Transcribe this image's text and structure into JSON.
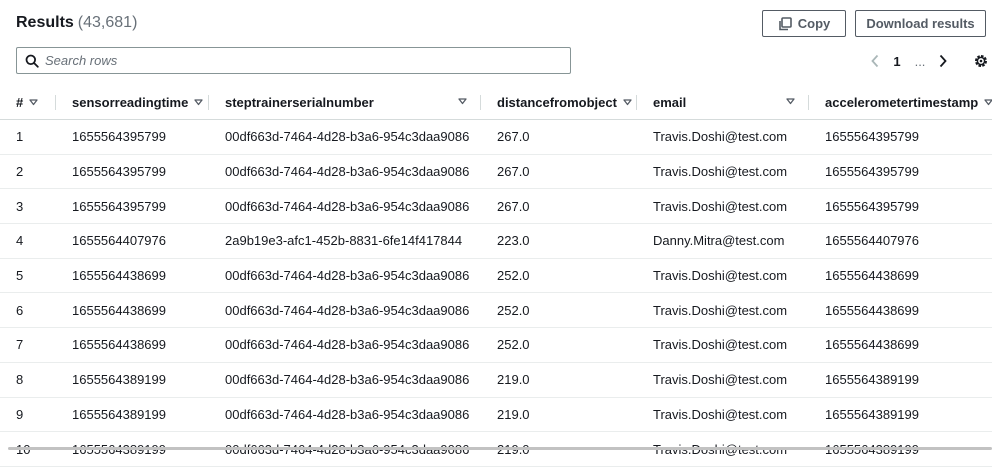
{
  "header": {
    "title": "Results",
    "count": "(43,681)"
  },
  "toolbar": {
    "copy_label": "Copy",
    "download_label": "Download results"
  },
  "search": {
    "placeholder": "Search rows",
    "value": ""
  },
  "pagination": {
    "current_page": "1",
    "ellipsis": "..."
  },
  "icons": {
    "search": "search-icon",
    "copy": "copy-icon",
    "prev": "chevron-left-icon",
    "next": "chevron-right-icon",
    "settings": "gear-icon",
    "sort": "sort-caret-down-icon"
  },
  "table": {
    "columns": [
      "#",
      "sensorreadingtime",
      "steptrainerserialnumber",
      "distancefromobject",
      "email",
      "accelerometertimestamp"
    ],
    "rows": [
      [
        "1",
        "1655564395799",
        "00df663d-7464-4d28-b3a6-954c3daa9086",
        "267.0",
        "Travis.Doshi@test.com",
        "1655564395799"
      ],
      [
        "2",
        "1655564395799",
        "00df663d-7464-4d28-b3a6-954c3daa9086",
        "267.0",
        "Travis.Doshi@test.com",
        "1655564395799"
      ],
      [
        "3",
        "1655564395799",
        "00df663d-7464-4d28-b3a6-954c3daa9086",
        "267.0",
        "Travis.Doshi@test.com",
        "1655564395799"
      ],
      [
        "4",
        "1655564407976",
        "2a9b19e3-afc1-452b-8831-6fe14f417844",
        "223.0",
        "Danny.Mitra@test.com",
        "1655564407976"
      ],
      [
        "5",
        "1655564438699",
        "00df663d-7464-4d28-b3a6-954c3daa9086",
        "252.0",
        "Travis.Doshi@test.com",
        "1655564438699"
      ],
      [
        "6",
        "1655564438699",
        "00df663d-7464-4d28-b3a6-954c3daa9086",
        "252.0",
        "Travis.Doshi@test.com",
        "1655564438699"
      ],
      [
        "7",
        "1655564438699",
        "00df663d-7464-4d28-b3a6-954c3daa9086",
        "252.0",
        "Travis.Doshi@test.com",
        "1655564438699"
      ],
      [
        "8",
        "1655564389199",
        "00df663d-7464-4d28-b3a6-954c3daa9086",
        "219.0",
        "Travis.Doshi@test.com",
        "1655564389199"
      ],
      [
        "9",
        "1655564389199",
        "00df663d-7464-4d28-b3a6-954c3daa9086",
        "219.0",
        "Travis.Doshi@test.com",
        "1655564389199"
      ],
      [
        "10",
        "1655564389199",
        "00df663d-7464-4d28-b3a6-954c3daa9086",
        "219.0",
        "Travis.Doshi@test.com",
        "1655564389199"
      ]
    ]
  },
  "colors": {
    "text": "#16191f",
    "muted": "#687078",
    "border": "#d5dbdb",
    "button_border": "#545b64"
  }
}
